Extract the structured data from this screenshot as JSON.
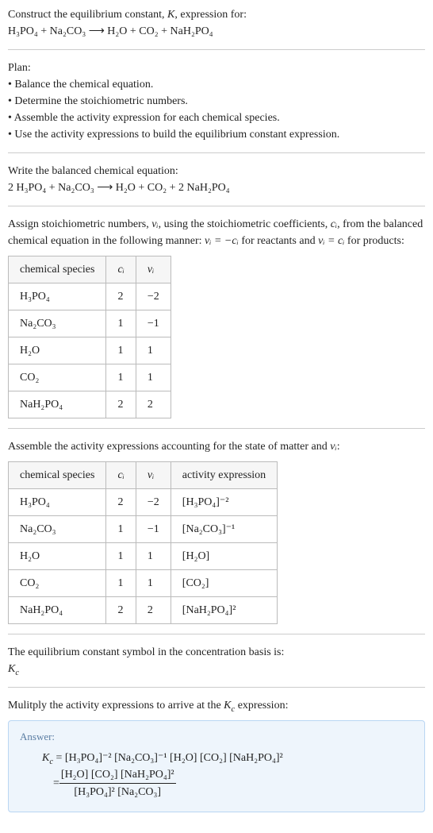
{
  "intro": {
    "line1_a": "Construct the equilibrium constant, ",
    "line1_b": ", expression for:",
    "eq_reactants": "H₃PO₄ + Na₂CO₃",
    "arrow": " ⟶ ",
    "eq_products": "H₂O + CO₂ + NaH₂PO₄"
  },
  "plan": {
    "title": "Plan:",
    "b1": "• Balance the chemical equation.",
    "b2": "• Determine the stoichiometric numbers.",
    "b3": "• Assemble the activity expression for each chemical species.",
    "b4": "• Use the activity expressions to build the equilibrium constant expression."
  },
  "balanced": {
    "title": "Write the balanced chemical equation:",
    "reactants": "2 H₃PO₄ + Na₂CO₃",
    "arrow": " ⟶ ",
    "products": "H₂O + CO₂ + 2 NaH₂PO₄"
  },
  "stoich_text": {
    "a": "Assign stoichiometric numbers, ",
    "nu": "νᵢ",
    "b": ", using the stoichiometric coefficients, ",
    "ci": "cᵢ",
    "c": ", from the balanced chemical equation in the following manner: ",
    "eq1": "νᵢ = −cᵢ",
    "d": " for reactants and ",
    "eq2": "νᵢ = cᵢ",
    "e": " for products:"
  },
  "table1": {
    "h1": "chemical species",
    "h2": "cᵢ",
    "h3": "νᵢ",
    "rows": [
      {
        "s": "H₃PO₄",
        "c": "2",
        "v": "−2"
      },
      {
        "s": "Na₂CO₃",
        "c": "1",
        "v": "−1"
      },
      {
        "s": "H₂O",
        "c": "1",
        "v": "1"
      },
      {
        "s": "CO₂",
        "c": "1",
        "v": "1"
      },
      {
        "s": "NaH₂PO₄",
        "c": "2",
        "v": "2"
      }
    ]
  },
  "assemble": {
    "a": "Assemble the activity expressions accounting for the state of matter and ",
    "nu": "νᵢ",
    "b": ":"
  },
  "table2": {
    "h1": "chemical species",
    "h2": "cᵢ",
    "h3": "νᵢ",
    "h4": "activity expression",
    "rows": [
      {
        "s": "H₃PO₄",
        "c": "2",
        "v": "−2",
        "a": "[H₃PO₄]⁻²"
      },
      {
        "s": "Na₂CO₃",
        "c": "1",
        "v": "−1",
        "a": "[Na₂CO₃]⁻¹"
      },
      {
        "s": "H₂O",
        "c": "1",
        "v": "1",
        "a": "[H₂O]"
      },
      {
        "s": "CO₂",
        "c": "1",
        "v": "1",
        "a": "[CO₂]"
      },
      {
        "s": "NaH₂PO₄",
        "c": "2",
        "v": "2",
        "a": "[NaH₂PO₄]²"
      }
    ]
  },
  "kc_text": {
    "line1": "The equilibrium constant symbol in the concentration basis is:",
    "kc": "K",
    "kc_sub": "c"
  },
  "multiply": {
    "a": "Mulitply the activity expressions to arrive at the ",
    "kc": "K",
    "kc_sub": "c",
    "b": " expression:"
  },
  "answer": {
    "label": "Answer:",
    "kc": "K",
    "kc_sub": "c",
    "eq": " = ",
    "flat": "[H₃PO₄]⁻² [Na₂CO₃]⁻¹ [H₂O] [CO₂] [NaH₂PO₄]²",
    "eq2": " = ",
    "num": "[H₂O] [CO₂] [NaH₂PO₄]²",
    "den": "[H₃PO₄]² [Na₂CO₃]"
  }
}
